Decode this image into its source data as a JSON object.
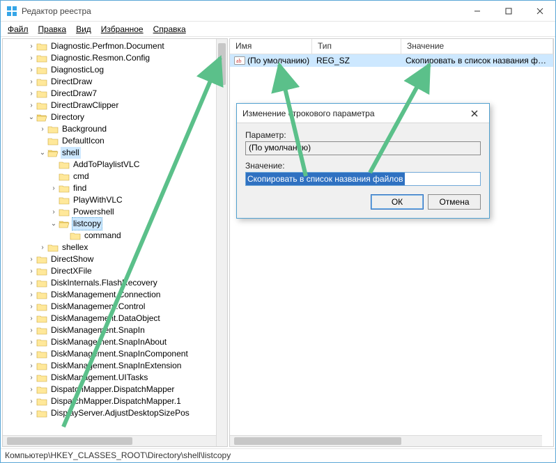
{
  "window": {
    "title": "Редактор реестра"
  },
  "menu": {
    "file": "Файл",
    "edit": "Правка",
    "view": "Вид",
    "favorites": "Избранное",
    "help": "Справка"
  },
  "statusbar": "Компьютер\\HKEY_CLASSES_ROOT\\Directory\\shell\\listcopy",
  "list": {
    "cols": {
      "name": "Имя",
      "type": "Тип",
      "value": "Значение"
    },
    "rows": [
      {
        "name": "(По умолчанию)",
        "type": "REG_SZ",
        "value": "Скопировать в список названия файлов"
      }
    ]
  },
  "dialog": {
    "title": "Изменение строкового параметра",
    "param_label": "Параметр:",
    "param_value": "(По умолчанию)",
    "value_label": "Значение:",
    "value_text": "Скопировать в список названия файлов",
    "ok": "ОК",
    "cancel": "Отмена"
  },
  "tree": [
    {
      "d": 2,
      "t": ">",
      "l": "Diagnostic.Perfmon.Document"
    },
    {
      "d": 2,
      "t": ">",
      "l": "Diagnostic.Resmon.Config"
    },
    {
      "d": 2,
      "t": ">",
      "l": "DiagnosticLog"
    },
    {
      "d": 2,
      "t": ">",
      "l": "DirectDraw"
    },
    {
      "d": 2,
      "t": ">",
      "l": "DirectDraw7"
    },
    {
      "d": 2,
      "t": ">",
      "l": "DirectDrawClipper"
    },
    {
      "d": 2,
      "t": "v",
      "l": "Directory"
    },
    {
      "d": 3,
      "t": ">",
      "l": "Background"
    },
    {
      "d": 3,
      "t": " ",
      "l": "DefaultIcon"
    },
    {
      "d": 3,
      "t": "v",
      "l": "shell",
      "hl": true
    },
    {
      "d": 4,
      "t": " ",
      "l": "AddToPlaylistVLC"
    },
    {
      "d": 4,
      "t": " ",
      "l": "cmd"
    },
    {
      "d": 4,
      "t": ">",
      "l": "find"
    },
    {
      "d": 4,
      "t": " ",
      "l": "PlayWithVLC"
    },
    {
      "d": 4,
      "t": ">",
      "l": "Powershell"
    },
    {
      "d": 4,
      "t": "v",
      "l": "listcopy",
      "sel": true
    },
    {
      "d": 5,
      "t": " ",
      "l": "command"
    },
    {
      "d": 3,
      "t": ">",
      "l": "shellex"
    },
    {
      "d": 2,
      "t": ">",
      "l": "DirectShow"
    },
    {
      "d": 2,
      "t": ">",
      "l": "DirectXFile"
    },
    {
      "d": 2,
      "t": ">",
      "l": "DiskInternals.FlashRecovery"
    },
    {
      "d": 2,
      "t": ">",
      "l": "DiskManagement.Connection"
    },
    {
      "d": 2,
      "t": ">",
      "l": "DiskManagement.Control"
    },
    {
      "d": 2,
      "t": ">",
      "l": "DiskManagement.DataObject"
    },
    {
      "d": 2,
      "t": ">",
      "l": "DiskManagement.SnapIn"
    },
    {
      "d": 2,
      "t": ">",
      "l": "DiskManagement.SnapInAbout"
    },
    {
      "d": 2,
      "t": ">",
      "l": "DiskManagement.SnapInComponent"
    },
    {
      "d": 2,
      "t": ">",
      "l": "DiskManagement.SnapInExtension"
    },
    {
      "d": 2,
      "t": ">",
      "l": "DiskManagement.UITasks"
    },
    {
      "d": 2,
      "t": ">",
      "l": "DispatchMapper.DispatchMapper"
    },
    {
      "d": 2,
      "t": ">",
      "l": "DispatchMapper.DispatchMapper.1"
    },
    {
      "d": 2,
      "t": ">",
      "l": "DisplayServer.AdjustDesktopSizePos"
    }
  ]
}
